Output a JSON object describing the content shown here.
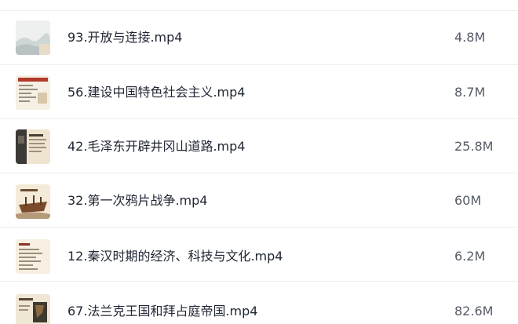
{
  "files": [
    {
      "name": "93.开放与连接.mp4",
      "size": "4.8M",
      "thumb": "landscape"
    },
    {
      "name": "56.建设中国特色社会主义.mp4",
      "size": "8.7M",
      "thumb": "text-slide"
    },
    {
      "name": "42.毛泽东开辟井冈山道路.mp4",
      "size": "25.8M",
      "thumb": "portrait-slide"
    },
    {
      "name": "32.第一次鸦片战争.mp4",
      "size": "60M",
      "thumb": "ship-slide"
    },
    {
      "name": "12.秦汉时期的经济、科技与文化.mp4",
      "size": "6.2M",
      "thumb": "text-slide"
    },
    {
      "name": "67.法兰克王国和拜占庭帝国.mp4",
      "size": "82.6M",
      "thumb": "map-slide"
    }
  ]
}
